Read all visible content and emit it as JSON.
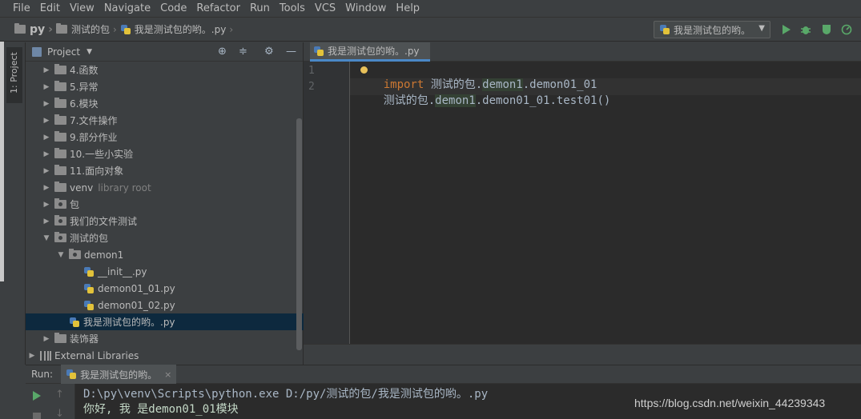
{
  "menu": [
    "File",
    "Edit",
    "View",
    "Navigate",
    "Code",
    "Refactor",
    "Run",
    "Tools",
    "VCS",
    "Window",
    "Help"
  ],
  "breadcrumb": [
    "py",
    "测试的包",
    "我是测试包的哟。.py"
  ],
  "run_config": "我是测试包的哟。",
  "left_tool_tab": "1: Project",
  "project_panel": {
    "title": "Project",
    "tree": [
      {
        "label": "4.函数",
        "indent": 0,
        "type": "folder",
        "expanded": false
      },
      {
        "label": "5.异常",
        "indent": 0,
        "type": "folder",
        "expanded": false
      },
      {
        "label": "6.模块",
        "indent": 0,
        "type": "folder",
        "expanded": false
      },
      {
        "label": "7.文件操作",
        "indent": 0,
        "type": "folder",
        "expanded": false
      },
      {
        "label": "9.部分作业",
        "indent": 0,
        "type": "folder",
        "expanded": false
      },
      {
        "label": "10.一些小实验",
        "indent": 0,
        "type": "folder",
        "expanded": false
      },
      {
        "label": "11.面向对象",
        "indent": 0,
        "type": "folder",
        "expanded": false
      },
      {
        "label": "venv",
        "hint": "library root",
        "indent": 0,
        "type": "folder",
        "expanded": false
      },
      {
        "label": "包",
        "indent": 0,
        "type": "package",
        "expanded": false
      },
      {
        "label": "我们的文件测试",
        "indent": 0,
        "type": "package",
        "expanded": false
      },
      {
        "label": "测试的包",
        "indent": 0,
        "type": "package",
        "expanded": true
      },
      {
        "label": "demon1",
        "indent": 1,
        "type": "package",
        "expanded": true
      },
      {
        "label": "__init__.py",
        "indent": 2,
        "type": "py"
      },
      {
        "label": "demon01_01.py",
        "indent": 2,
        "type": "py"
      },
      {
        "label": "demon01_02.py",
        "indent": 2,
        "type": "py"
      },
      {
        "label": "我是测试包的哟。.py",
        "indent": 1,
        "type": "py",
        "selected": true
      },
      {
        "label": "装饰器",
        "indent": 0,
        "type": "folder",
        "expanded": false
      },
      {
        "label": "External Libraries",
        "indent": -1,
        "type": "lib",
        "expanded": false
      }
    ]
  },
  "editor": {
    "tab": "我是测试包的哟。.py",
    "lines": [
      {
        "no": "1",
        "kw": "import",
        "rest1": " 测试的包.",
        "hl": "demon1",
        "rest2": ".demon01_01"
      },
      {
        "no": "2",
        "kw": "",
        "rest1": "测试的包.",
        "hl": "demon1",
        "rest2": ".demon01_01.test01()"
      }
    ]
  },
  "run": {
    "label": "Run:",
    "tab": "我是测试包的哟。",
    "console": [
      "D:\\py\\venv\\Scripts\\python.exe D:/py/测试的包/我是测试包的哟。.py",
      "你好, 我 是demon01_01模块"
    ]
  },
  "watermark": "https://blog.csdn.net/weixin_44239343",
  "colors": {
    "run_green": "#59a869",
    "selection": "#0d293e",
    "keyword": "#cc7832"
  }
}
